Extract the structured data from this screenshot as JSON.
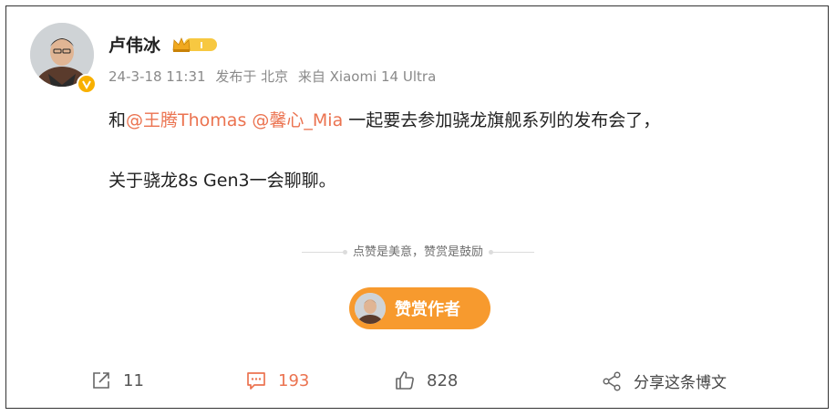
{
  "post": {
    "username": "卢伟冰",
    "meta": {
      "date": "24-3-18 11:31",
      "published_in": "发布于 北京",
      "source": "来自 Xiaomi 14 Ultra"
    },
    "line1_prefix": "和",
    "mention1": "@王腾Thomas",
    "mention2": "@馨心_Mia",
    "line1_suffix": "一起要去参加骁龙旗舰系列的发布会了，",
    "line2": "关于骁龙8s Gen3一会聊聊。"
  },
  "reward": {
    "caption": "点赞是美意，赞赏是鼓励",
    "button_label": "赞赏作者"
  },
  "actions": {
    "repost_count": "11",
    "comment_count": "193",
    "like_count": "828",
    "share_label": "分享这条博文"
  },
  "colors": {
    "mention": "#eb7350",
    "reward_button": "#f79a2e",
    "verified_badge": "#f8b000"
  }
}
